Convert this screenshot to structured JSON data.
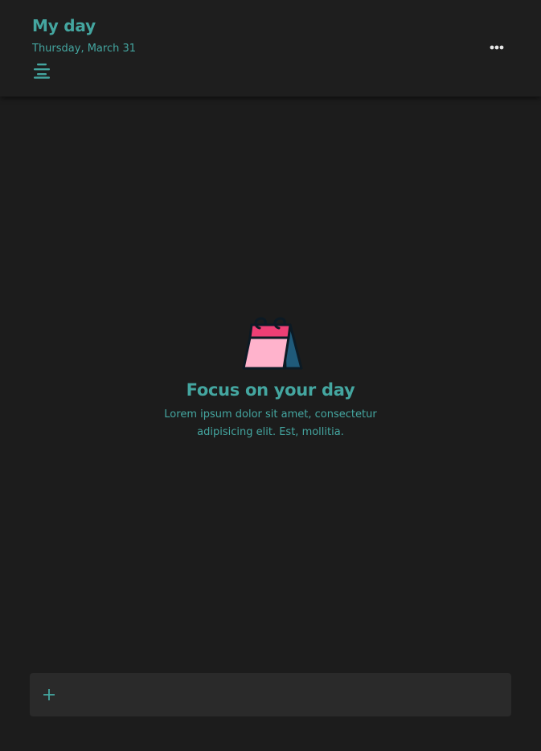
{
  "header": {
    "title": "My day",
    "date": "Thursday, March 31"
  },
  "icons": {
    "sort": "sort-icon",
    "more": "more-horizontal-icon",
    "illustration": "calendar-icon",
    "add": "plus-icon"
  },
  "empty_state": {
    "title": "Focus on your day",
    "description": "Lorem ipsum dolor sit amet, consectetur adipisicing elit. Est, mollitia."
  },
  "add_task": {
    "placeholder": "",
    "value": ""
  },
  "colors": {
    "accent": "#44a6a0",
    "background": "#1c1c1c",
    "header": "#1e1e1e",
    "input_bar": "#2a2a2a",
    "calendar_top": "#ee3f75",
    "calendar_page": "#ffb3cc",
    "calendar_back": "#1f5a7a"
  }
}
